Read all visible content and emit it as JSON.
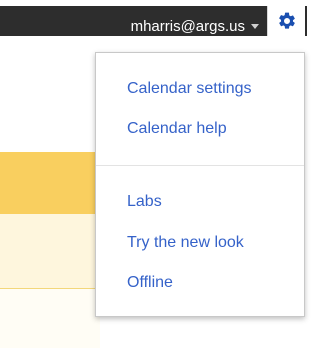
{
  "header": {
    "account_email": "mharris@args.us",
    "caret_icon": "caret-down-icon",
    "gear_icon": "gear-icon",
    "gear_color": "#1a4fb0"
  },
  "settings_menu": {
    "group1": [
      "Calendar settings",
      "Calendar help"
    ],
    "group2": [
      "Labs",
      "Try the new look",
      "Offline"
    ]
  },
  "colors": {
    "topbar": "#2d2d2d",
    "link": "#3562c9",
    "highlight_yellow": "#f9cf5f",
    "highlight_pale": "#fef6dd"
  }
}
